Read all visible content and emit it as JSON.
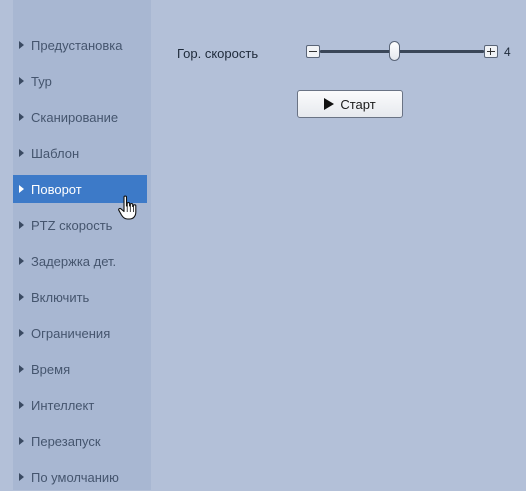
{
  "sidebar": {
    "items": [
      {
        "label": "Предустановка",
        "active": false
      },
      {
        "label": "Тур",
        "active": false
      },
      {
        "label": "Сканирование",
        "active": false
      },
      {
        "label": "Шаблон",
        "active": false
      },
      {
        "label": "Поворот",
        "active": true
      },
      {
        "label": "PTZ скорость",
        "active": false
      },
      {
        "label": "Задержка дет.",
        "active": false
      },
      {
        "label": "Включить",
        "active": false
      },
      {
        "label": "Ограничения",
        "active": false
      },
      {
        "label": "Время",
        "active": false
      },
      {
        "label": "Интеллект",
        "active": false
      },
      {
        "label": "Перезапуск",
        "active": false
      },
      {
        "label": "По умолчанию",
        "active": false
      }
    ]
  },
  "main": {
    "speed_label": "Гор. скорость",
    "speed_value": "4",
    "speed_slider_level": 0.42,
    "start_label": "Старт"
  },
  "icons": {
    "menu_arrow": "right-triangle-icon",
    "play": "play-icon",
    "cursor": "hand-pointer-icon"
  },
  "colors": {
    "background": "#b3c0d8",
    "sidebar": "#a8b7d2",
    "active_item": "#3d7ac8",
    "menu_text": "#45556e"
  }
}
